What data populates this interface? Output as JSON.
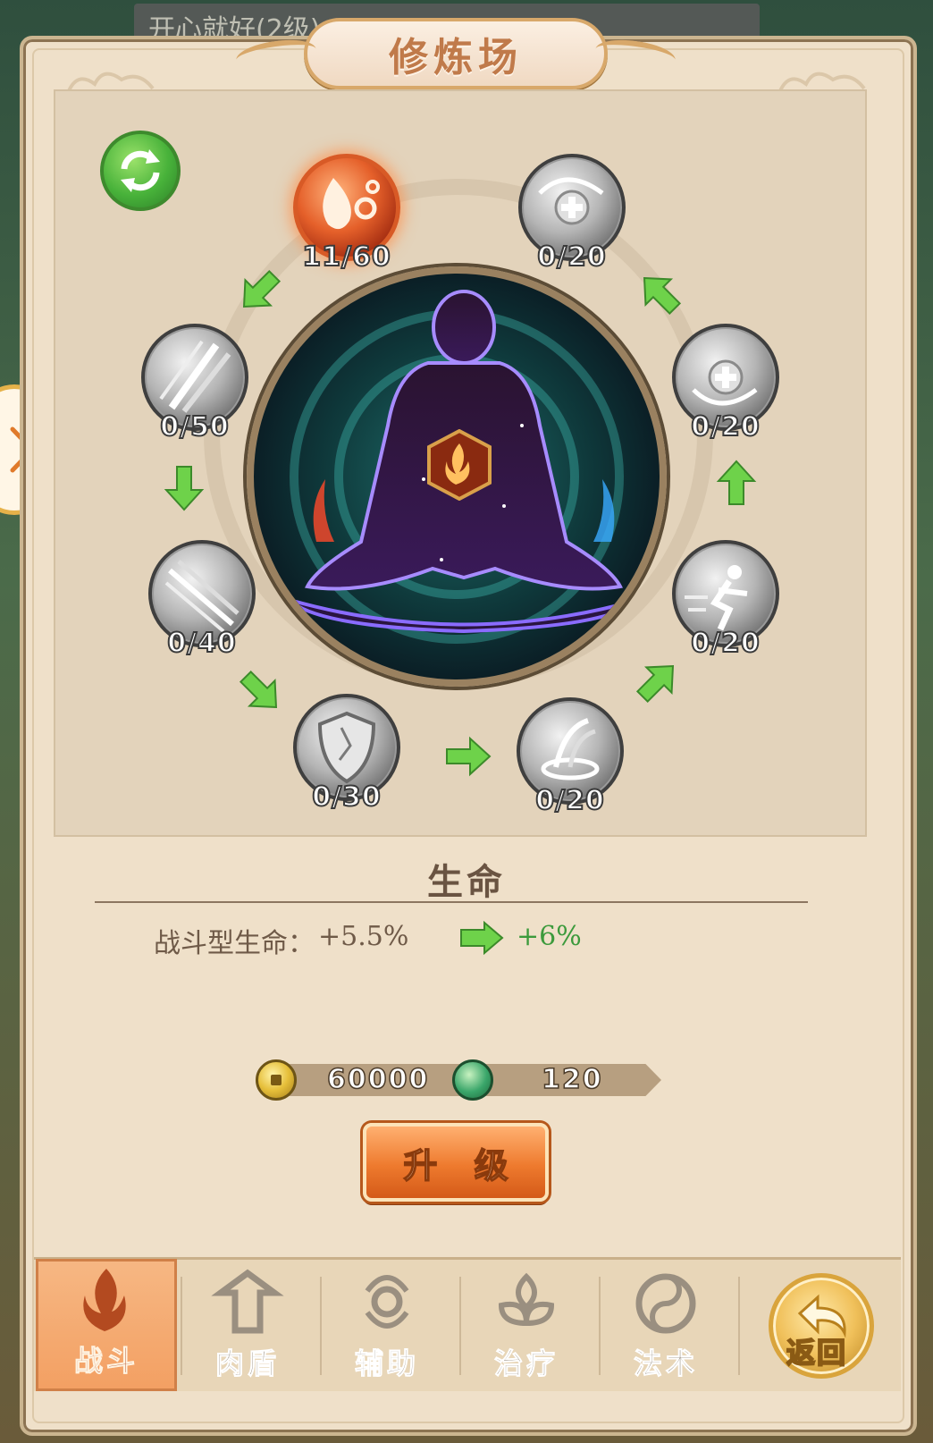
{
  "background": {
    "header_title": "开心就好(2级)"
  },
  "panel": {
    "title": "修炼场"
  },
  "refresh": {
    "icon": "refresh-icon"
  },
  "nodes": [
    {
      "id": "fire-drop",
      "count": "11/60",
      "active": true
    },
    {
      "id": "silver-plus-1",
      "count": "0/20",
      "active": false
    },
    {
      "id": "silver-slash",
      "count": "0/50",
      "active": false
    },
    {
      "id": "silver-plus-2",
      "count": "0/20",
      "active": false
    },
    {
      "id": "silver-blades",
      "count": "0/40",
      "active": false
    },
    {
      "id": "silver-sprint",
      "count": "0/20",
      "active": false
    },
    {
      "id": "silver-shield",
      "count": "0/30",
      "active": false
    },
    {
      "id": "silver-whirl",
      "count": "0/20",
      "active": false
    }
  ],
  "stat": {
    "title": "生命",
    "label": "战斗型生命：",
    "current": "+5.5%",
    "next": "+6%"
  },
  "cost": {
    "gold": "60000",
    "jade": "120"
  },
  "upgrade": {
    "label": "升 级"
  },
  "tabs": [
    {
      "label": "战斗",
      "active": true
    },
    {
      "label": "肉盾",
      "active": false
    },
    {
      "label": "辅助",
      "active": false
    },
    {
      "label": "治疗",
      "active": false
    },
    {
      "label": "法术",
      "active": false
    }
  ],
  "back": {
    "label": "返回"
  },
  "colors": {
    "panel": "#efe0c9",
    "accent_orange": "#ee7a2e",
    "green": "#3c9a3c",
    "title": "#c07a4a"
  }
}
